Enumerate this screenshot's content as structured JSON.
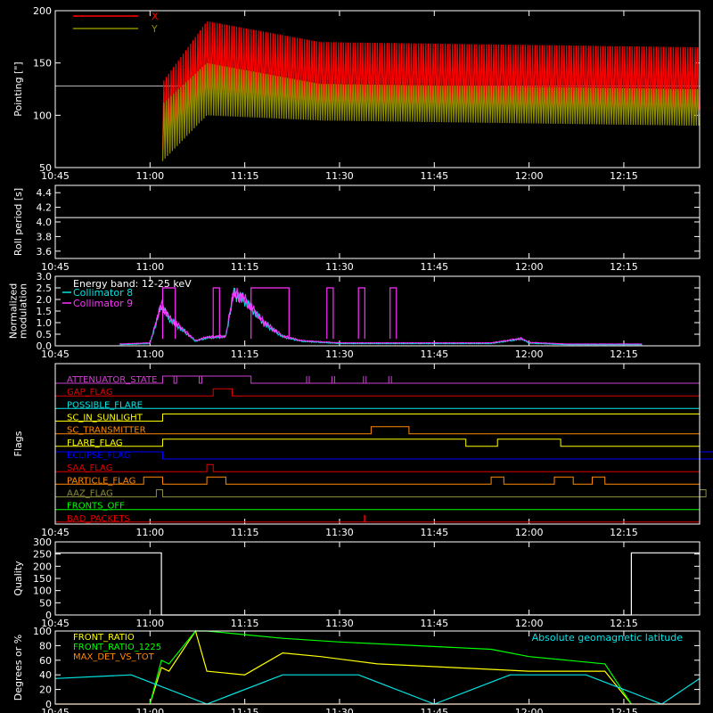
{
  "colors": {
    "background": "#000000",
    "axis": "#ffffff",
    "red": "#ff0000",
    "olive": "#8c8c00",
    "white": "#ffffff",
    "cyan": "#00e5e5",
    "magenta": "#ff30ff",
    "yellow": "#ffff00",
    "orange": "#ff8800",
    "blue": "#0000ff",
    "green": "#00ff00",
    "gray": "#b4b4b4",
    "flag_magenta": "#d040d0",
    "flag_red": "#e00000",
    "olivegreen": "#8c8c3c"
  },
  "chart_data": [
    {
      "type": "line",
      "panel": "pointing",
      "ylabel": "Pointing [\"]",
      "ylim": [
        50,
        200
      ],
      "yticks": [
        "50",
        "100",
        "150",
        "200"
      ],
      "xticks": [
        "10:45",
        "11:00",
        "11:15",
        "11:30",
        "11:45",
        "12:00",
        "12:15"
      ],
      "xrange_hours": [
        10.75,
        12.45
      ],
      "legend_position": "top-left",
      "series": [
        {
          "name": "X",
          "color": "red",
          "data_window": [
            "11:02",
            "12:27"
          ],
          "min_envelope": [
            [
              11.03,
              65
            ],
            [
              11.15,
              120
            ],
            [
              11.45,
              108
            ],
            [
              12.45,
              105
            ]
          ],
          "max_envelope": [
            [
              11.03,
              130
            ],
            [
              11.15,
              190
            ],
            [
              11.45,
              170
            ],
            [
              12.45,
              165
            ]
          ]
        },
        {
          "name": "Y",
          "color": "olive",
          "data_window": [
            "11:02",
            "12:27"
          ],
          "min_envelope": [
            [
              11.03,
              55
            ],
            [
              11.15,
              100
            ],
            [
              11.45,
              95
            ],
            [
              12.45,
              90
            ]
          ],
          "max_envelope": [
            [
              11.03,
              110
            ],
            [
              11.15,
              150
            ],
            [
              11.45,
              130
            ],
            [
              12.45,
              125
            ]
          ]
        }
      ],
      "reference_level": 128
    },
    {
      "type": "line",
      "panel": "roll",
      "ylabel": "Roll period [s]",
      "ylim": [
        3.5,
        4.5
      ],
      "yticks": [
        "3.6",
        "3.8",
        "4.0",
        "4.2",
        "4.4"
      ],
      "xticks": [
        "10:45",
        "11:00",
        "11:15",
        "11:30",
        "11:45",
        "12:00",
        "12:15"
      ],
      "series": [
        {
          "color": "white",
          "x": [
            10.75,
            12.45
          ],
          "y": [
            4.06,
            4.06
          ]
        }
      ]
    },
    {
      "type": "line",
      "panel": "modulation",
      "ylabel_lines": [
        "Normalized",
        "modulation"
      ],
      "ylim": [
        0,
        3
      ],
      "yticks": [
        "0.0",
        "0.5",
        "1.0",
        "1.5",
        "2.0",
        "2.5",
        "3.0"
      ],
      "xticks": [
        "10:45",
        "11:00",
        "11:15",
        "11:30",
        "11:45",
        "12:00",
        "12:15"
      ],
      "legend_title": "Energy band: 12-25 keV",
      "legend_position": "top-left",
      "series": [
        {
          "name": "Collimator 8",
          "color": "cyan"
        },
        {
          "name": "Collimator 9",
          "color": "magenta"
        }
      ],
      "profile": [
        [
          10.92,
          0.05
        ],
        [
          11.0,
          0.1
        ],
        [
          11.03,
          1.8
        ],
        [
          11.05,
          1.2
        ],
        [
          11.1,
          0.5
        ],
        [
          11.12,
          0.2
        ],
        [
          11.15,
          0.35
        ],
        [
          11.2,
          0.4
        ],
        [
          11.22,
          2.3
        ],
        [
          11.25,
          2.0
        ],
        [
          11.3,
          1.0
        ],
        [
          11.35,
          0.4
        ],
        [
          11.4,
          0.2
        ],
        [
          11.5,
          0.1
        ],
        [
          11.9,
          0.1
        ],
        [
          11.98,
          0.3
        ],
        [
          12.0,
          0.12
        ],
        [
          12.1,
          0.05
        ],
        [
          12.3,
          0.05
        ]
      ],
      "saturation_windows": [
        [
          "11:02",
          "11:04"
        ],
        [
          "11:10",
          "11:11"
        ],
        [
          "11:16",
          "11:22"
        ],
        [
          "11:28",
          "11:29"
        ],
        [
          "11:33",
          "11:34"
        ],
        [
          "11:38",
          "11:39"
        ]
      ]
    },
    {
      "type": "table",
      "panel": "flags",
      "ylabel": "Flags",
      "xticks": [
        "10:45",
        "11:00",
        "11:15",
        "11:30",
        "11:45",
        "12:00",
        "12:15"
      ],
      "flags": [
        {
          "name": "ATTENUATOR_STATE",
          "color": "flag_magenta",
          "high": [
            [
              "11:02",
              "11:16"
            ]
          ],
          "dips": [
            "11:04",
            "11:08",
            "11:25",
            "11:29",
            "11:34",
            "11:38"
          ]
        },
        {
          "name": "GAP_FLAG",
          "color": "flag_red",
          "high": [
            [
              "11:10",
              "11:13"
            ]
          ]
        },
        {
          "name": "POSSIBLE_FLARE",
          "color": "cyan",
          "high": []
        },
        {
          "name": "SC_IN_SUNLIGHT",
          "color": "yellow",
          "high": [
            [
              "11:02",
              "12:27"
            ]
          ]
        },
        {
          "name": "SC_TRANSMITTER",
          "color": "orange",
          "high": [
            [
              "11:35",
              "11:41"
            ]
          ]
        },
        {
          "name": "FLARE_FLAG",
          "color": "yellow",
          "high": [
            [
              "11:02",
              "11:50"
            ],
            [
              "11:55",
              "12:05"
            ]
          ]
        },
        {
          "name": "ECLIPSE_FLAG",
          "color": "blue",
          "high": [
            [
              "10:45",
              "11:02"
            ],
            [
              "12:27",
              "12:35"
            ]
          ]
        },
        {
          "name": "SAA_FLAG",
          "color": "flag_red",
          "high": [
            [
              "11:09",
              "11:10"
            ]
          ]
        },
        {
          "name": "PARTICLE_FLAG",
          "color": "orange",
          "high": [
            [
              "10:59",
              "11:02"
            ],
            [
              "11:09",
              "11:12"
            ],
            [
              "11:54",
              "11:56"
            ],
            [
              "12:04",
              "12:07"
            ],
            [
              "12:10",
              "12:12"
            ]
          ]
        },
        {
          "name": "AAZ_FLAG",
          "color": "olivegreen",
          "high": [
            [
              "11:01",
              "11:02"
            ],
            [
              "12:27",
              "12:28"
            ]
          ]
        },
        {
          "name": "FRONTS_OFF",
          "color": "green",
          "high": []
        },
        {
          "name": "BAD_PACKETS",
          "color": "flag_red",
          "high": [],
          "spikes": [
            "11:34"
          ]
        }
      ]
    },
    {
      "type": "line",
      "panel": "quality",
      "ylabel": "Quality",
      "ylim": [
        0,
        300
      ],
      "yticks": [
        "0",
        "50",
        "100",
        "150",
        "200",
        "250",
        "300"
      ],
      "xticks": [
        "10:45",
        "11:00",
        "11:15",
        "11:30",
        "11:45",
        "12:00",
        "12:15"
      ],
      "series": [
        {
          "color": "white",
          "x": [
            10.75,
            11.03,
            11.03,
            12.27,
            12.27,
            12.45
          ],
          "y": [
            255,
            255,
            0,
            0,
            255,
            255
          ]
        }
      ]
    },
    {
      "type": "line",
      "panel": "ratios",
      "ylabel": "Degrees or %",
      "ylim": [
        0,
        100
      ],
      "yticks": [
        "0",
        "20",
        "40",
        "60",
        "80",
        "100"
      ],
      "xticks": [
        "10:45",
        "11:00",
        "11:15",
        "11:30",
        "11:45",
        "12:00",
        "12:15"
      ],
      "annotation": "Absolute geomagnetic latitude",
      "series": [
        {
          "name": "FRONT_RATIO",
          "color": "yellow",
          "x": [
            11.0,
            11.03,
            11.05,
            11.12,
            11.15,
            11.25,
            11.35,
            11.45,
            11.6,
            11.8,
            12.0,
            12.2,
            12.27
          ],
          "y": [
            0,
            50,
            45,
            100,
            45,
            40,
            70,
            65,
            55,
            50,
            45,
            45,
            0
          ]
        },
        {
          "name": "FRONT_RATIO_1225",
          "color": "green",
          "x": [
            11.0,
            11.03,
            11.05,
            11.12,
            11.15,
            11.25,
            11.35,
            11.5,
            11.7,
            11.9,
            12.0,
            12.2,
            12.27
          ],
          "y": [
            0,
            60,
            55,
            100,
            100,
            95,
            90,
            85,
            80,
            75,
            65,
            55,
            0
          ]
        },
        {
          "name": "MAX_DET_VS_TOT",
          "color": "orange",
          "x": [
            10.75,
            12.45
          ],
          "y": [
            0,
            0
          ]
        },
        {
          "name": "Absolute geomagnetic latitude",
          "color": "cyan",
          "x": [
            10.75,
            10.95,
            11.15,
            11.35,
            11.55,
            11.75,
            11.95,
            12.15,
            12.35,
            12.45
          ],
          "y": [
            35,
            40,
            0,
            40,
            40,
            0,
            40,
            40,
            0,
            35
          ]
        }
      ]
    }
  ]
}
